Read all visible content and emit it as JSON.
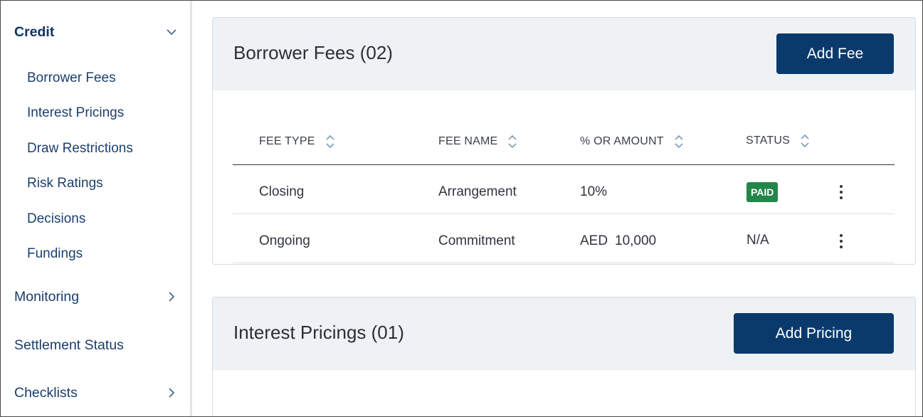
{
  "sidebar": {
    "groups": [
      {
        "label": "Credit",
        "expanded": true,
        "icon": "chevron-down-icon"
      },
      {
        "label": "Monitoring",
        "expanded": false,
        "icon": "chevron-right-icon"
      },
      {
        "label": "Settlement Status"
      },
      {
        "label": "Checklists",
        "expanded": false,
        "icon": "chevron-right-icon"
      }
    ],
    "credit_items": [
      {
        "label": "Borrower Fees"
      },
      {
        "label": "Interest Pricings"
      },
      {
        "label": "Draw Restrictions"
      },
      {
        "label": "Risk Ratings"
      },
      {
        "label": "Decisions"
      },
      {
        "label": "Fundings"
      }
    ]
  },
  "borrower_fees": {
    "title": "Borrower Fees (02)",
    "add_button": "Add Fee",
    "columns": [
      "FEE TYPE",
      "FEE NAME",
      "% OR AMOUNT",
      "STATUS"
    ],
    "rows": [
      {
        "fee_type": "Closing",
        "fee_name": "Arrangement",
        "amount_currency": "",
        "amount": "10%",
        "status": "PAID",
        "status_color": "#22854a"
      },
      {
        "fee_type": "Ongoing",
        "fee_name": "Commitment",
        "amount_currency": "AED",
        "amount": "10,000",
        "status": "N/A"
      }
    ]
  },
  "interest_pricings": {
    "title": "Interest Pricings (01)",
    "add_button": "Add Pricing"
  },
  "colors": {
    "primary": "#0a3a6c",
    "nav_text": "#1c406e",
    "paid_badge": "#22854a",
    "card_header_bg": "#eff2f5"
  }
}
